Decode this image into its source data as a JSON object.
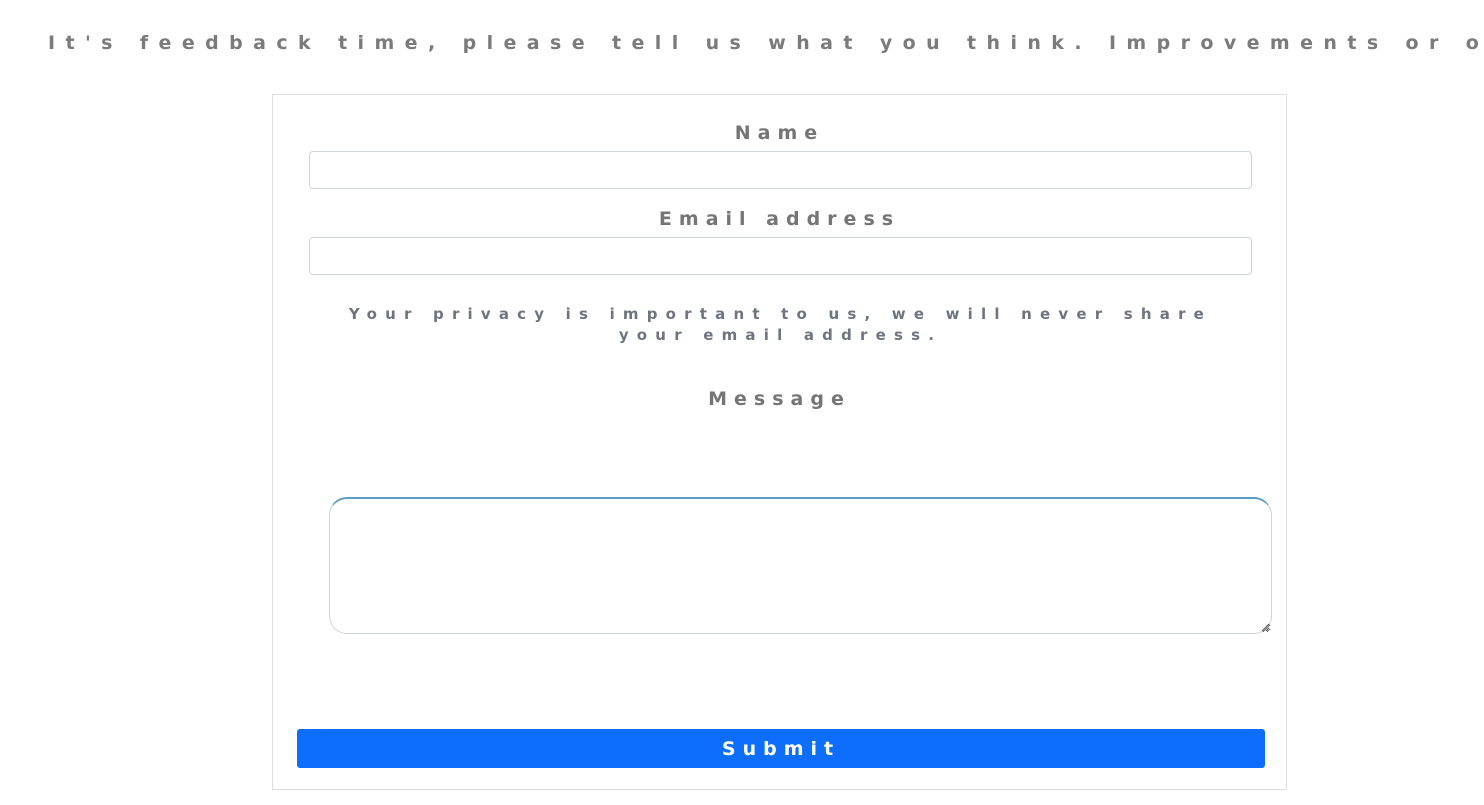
{
  "page": {
    "heading": "It's feedback time, please tell us what you think. Improvements or otherwise"
  },
  "form": {
    "name_label": "Name",
    "name_value": "",
    "name_placeholder": "",
    "email_label": "Email address",
    "email_value": "",
    "email_placeholder": "",
    "privacy_note": "Your privacy is important to us, we will never share your email address.",
    "message_label": "Message",
    "message_value": "",
    "submit_label": "Submit"
  },
  "colors": {
    "accent": "#0d6efd",
    "text_muted": "#7b7b7b",
    "focus_ring": "#5a9ec4"
  }
}
